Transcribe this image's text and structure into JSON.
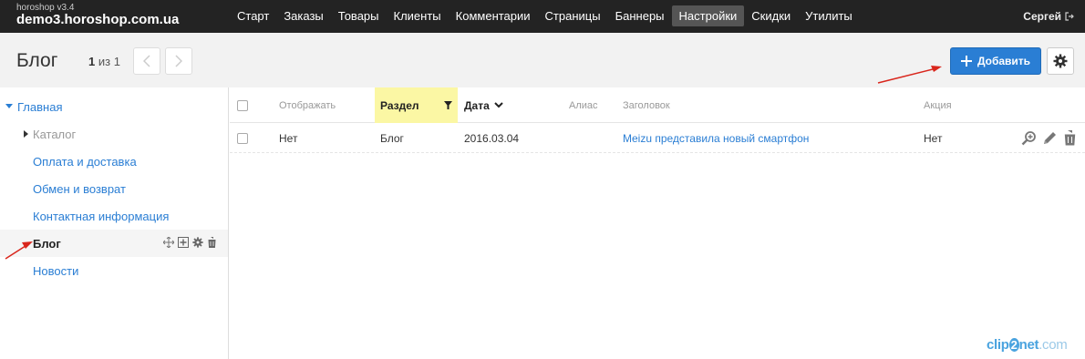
{
  "topbar": {
    "version": "horoshop v3.4",
    "domain": "demo3.horoshop.com.ua",
    "nav": [
      {
        "label": "Старт"
      },
      {
        "label": "Заказы"
      },
      {
        "label": "Товары"
      },
      {
        "label": "Клиенты"
      },
      {
        "label": "Комментарии"
      },
      {
        "label": "Страницы"
      },
      {
        "label": "Баннеры"
      },
      {
        "label": "Настройки",
        "active": true
      },
      {
        "label": "Скидки"
      },
      {
        "label": "Утилиты"
      }
    ],
    "user": "Сергей"
  },
  "header": {
    "title": "Блог",
    "pager_current": "1",
    "pager_rest": "из 1",
    "add_label": "Добавить"
  },
  "sidebar": {
    "items": [
      {
        "label": "Главная",
        "expanded": true
      },
      {
        "label": "Каталог",
        "collapsed": true
      },
      {
        "label": "Оплата и доставка"
      },
      {
        "label": "Обмен и возврат"
      },
      {
        "label": "Контактная информация"
      },
      {
        "label": "Блог",
        "selected": true
      },
      {
        "label": "Новости"
      }
    ]
  },
  "table": {
    "columns": {
      "display": "Отображать",
      "section": "Раздел",
      "date": "Дата",
      "alias": "Алиас",
      "title": "Заголовок",
      "promo": "Акция"
    },
    "rows": [
      {
        "display": "Нет",
        "section": "Блог",
        "date": "2016.03.04",
        "alias": "",
        "title": "Meizu представила новый смартфон",
        "promo": "Нет"
      }
    ]
  },
  "watermark": {
    "part1": "clip",
    "part2": "2",
    "part3": "net",
    "part4": ".com"
  },
  "colors": {
    "accent": "#2a7ed4",
    "topbar": "#232323",
    "highlight": "#fbf7a4",
    "arrow": "#d9261c"
  }
}
